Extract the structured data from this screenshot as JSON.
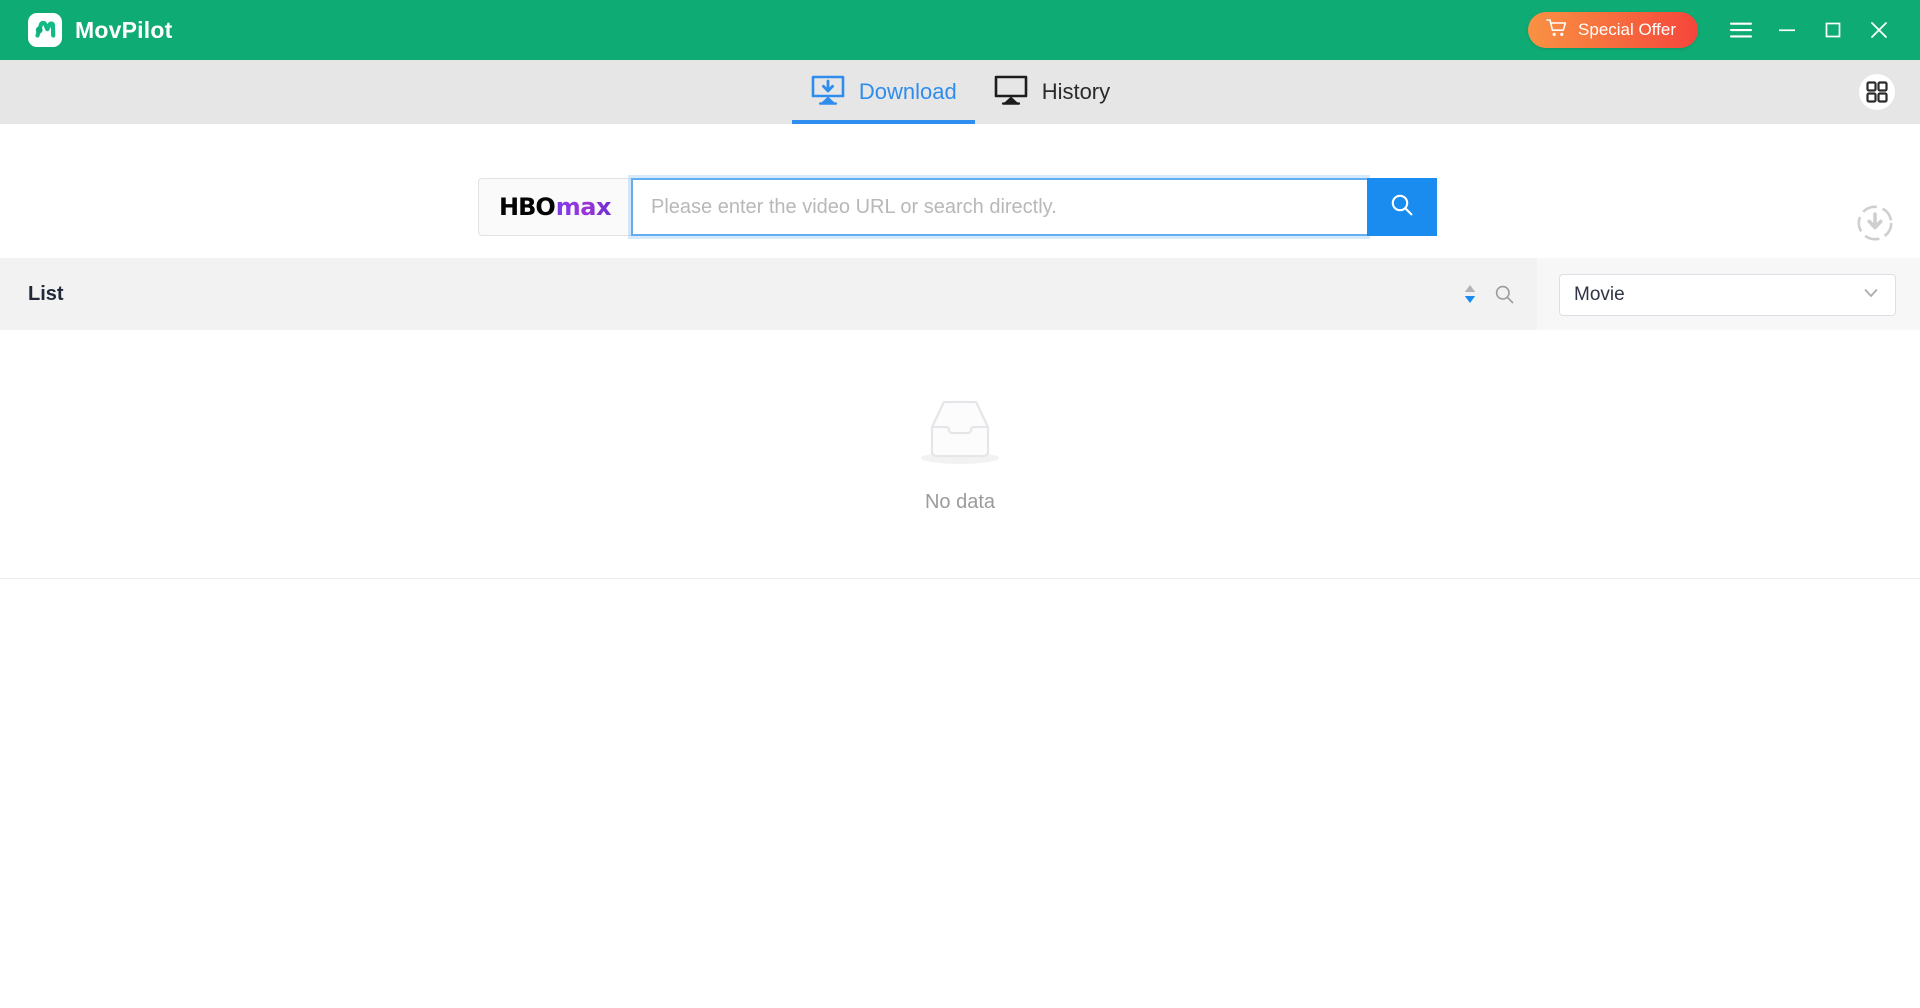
{
  "app": {
    "name": "MovPilot",
    "logo_icon": "movpilot-logo-icon",
    "brand_green": "#0fab74"
  },
  "titlebar": {
    "offer_button": {
      "label": "Special Offer",
      "icon": "shopping-cart-icon",
      "gradient_from": "#f89243",
      "gradient_to": "#f5453c"
    },
    "window_controls": [
      {
        "name": "menu",
        "icon": "hamburger-menu-icon"
      },
      {
        "name": "minimize",
        "icon": "minimize-icon"
      },
      {
        "name": "maximize",
        "icon": "maximize-icon"
      },
      {
        "name": "close",
        "icon": "close-icon"
      }
    ]
  },
  "tabs": {
    "items": [
      {
        "label": "Download",
        "icon": "download-monitor-icon",
        "active": true
      },
      {
        "label": "History",
        "icon": "monitor-icon",
        "active": false
      }
    ],
    "active_color": "#2f8ded",
    "grid_button_icon": "grid-apps-icon"
  },
  "search": {
    "platform": {
      "name": "HBO Max",
      "logo_part1": "HB",
      "logo_part2": "O",
      "logo_part3": "max"
    },
    "placeholder": "Please enter the video URL or search directly.",
    "value": "",
    "search_button_icon": "search-icon",
    "search_button_color": "#1a8cf0",
    "download_status_icon": "download-progress-icon"
  },
  "list": {
    "title": "List",
    "tools": [
      {
        "name": "sort",
        "icon": "sort-arrows-icon"
      },
      {
        "name": "search",
        "icon": "search-icon"
      }
    ],
    "type_filter": {
      "selected": "Movie",
      "chevron_icon": "chevron-down-icon"
    }
  },
  "empty_state": {
    "icon": "empty-inbox-icon",
    "label": "No data"
  }
}
